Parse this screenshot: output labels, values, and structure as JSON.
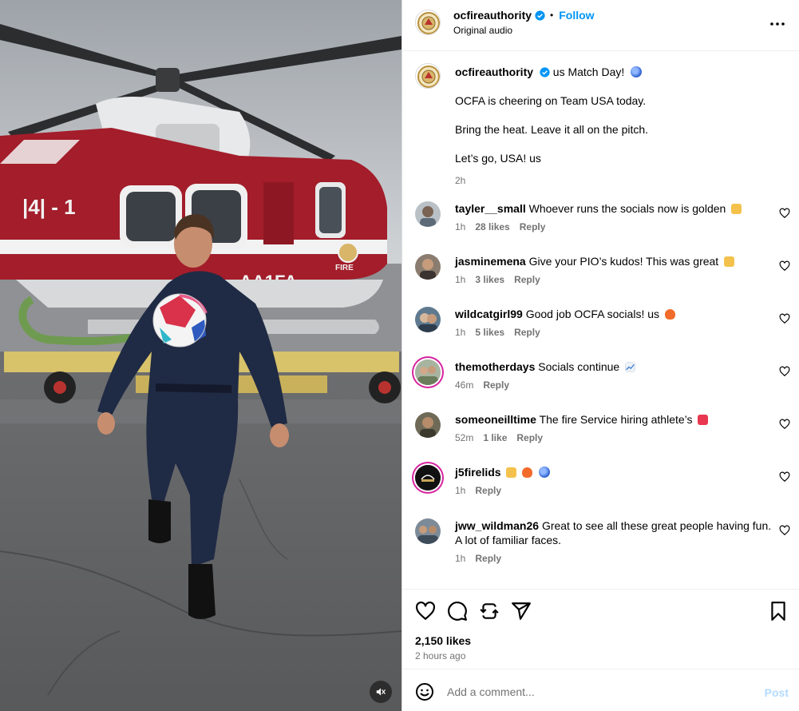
{
  "header": {
    "username": "ocfireauthority",
    "follow_label": "Follow",
    "audio": "Original audio",
    "dot": "•"
  },
  "caption": {
    "username": "ocfireauthority",
    "title_text": "us Match Day!",
    "lines": [
      "OCFA is cheering on Team USA today.",
      "Bring the heat. Leave it all on the pitch.",
      "Let’s go, USA! us"
    ],
    "time": "2h"
  },
  "comments": [
    {
      "username": "tayler__small",
      "text": "Whoever runs the socials now is golden",
      "time": "1h",
      "likes": "28 likes",
      "reply": "Reply",
      "emoji": "clap"
    },
    {
      "username": "jasminemena",
      "text": "Give your PIO’s kudos! This was great",
      "time": "1h",
      "likes": "3 likes",
      "reply": "Reply",
      "emoji": "clap"
    },
    {
      "username": "wildcatgirl99",
      "text": "Good job OCFA socials! us",
      "time": "1h",
      "likes": "5 likes",
      "reply": "Reply",
      "emoji": "fire"
    },
    {
      "username": "themotherdays",
      "text": "Socials continue",
      "time": "46m",
      "likes": "",
      "reply": "Reply",
      "emoji": "chart"
    },
    {
      "username": "someoneilltime",
      "text": "The fire Service hiring athlete’s",
      "time": "52m",
      "likes": "1 like",
      "reply": "Reply",
      "emoji": "100"
    },
    {
      "username": "j5firelids",
      "text": "",
      "time": "1h",
      "likes": "",
      "reply": "Reply",
      "emoji": "hands-fire-globe"
    },
    {
      "username": "jww_wildman26",
      "text": "Great to see all these great people having fun.",
      "text2": "A lot of familiar faces.",
      "time": "1h",
      "likes": "",
      "reply": "Reply",
      "emoji": ""
    }
  ],
  "post": {
    "likes": "2,150 likes",
    "posted": "2 hours ago"
  },
  "composer": {
    "placeholder": "Add a comment...",
    "post_label": "Post"
  },
  "icons": {
    "more": "more-horizontal-icon",
    "like": "heart-icon",
    "comment": "comment-icon",
    "repost": "repost-icon",
    "share": "share-icon",
    "save": "bookmark-icon",
    "mute": "muted-speaker-icon",
    "emoji": "smiley-icon"
  },
  "colors": {
    "accent": "#0095f6",
    "secondary_text": "#737373",
    "helicopter_red": "#a31d2a",
    "post_disabled": "#b3dbff"
  }
}
